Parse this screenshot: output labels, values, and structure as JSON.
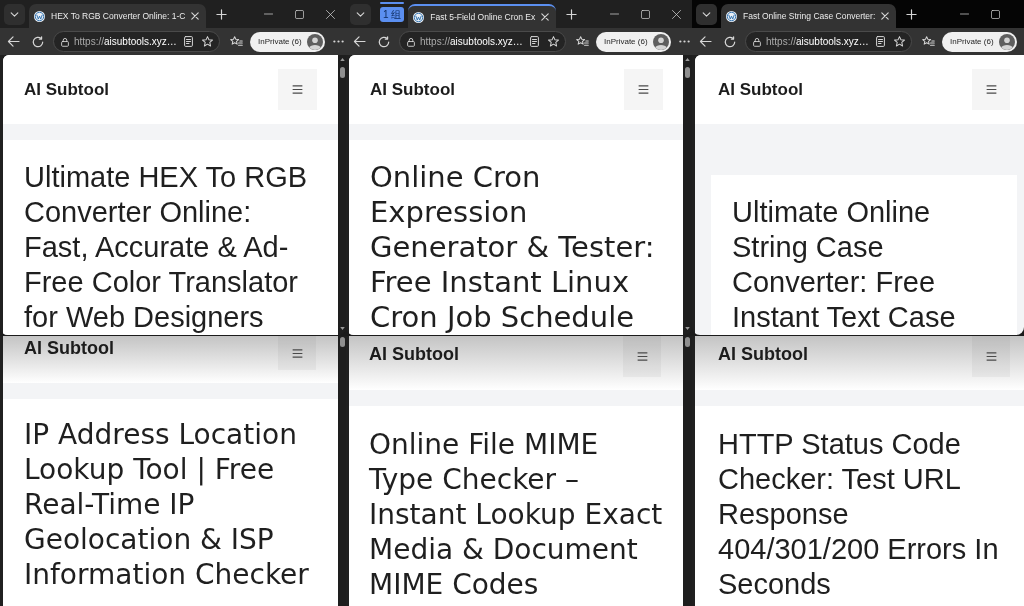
{
  "windows": [
    {
      "kind": "browser",
      "focused": false,
      "tabs": [
        {
          "title": "HEX To RGB Converter Online: 1-C",
          "selected": true
        }
      ],
      "toolbar": [
        {
          "kind": "back"
        },
        {
          "kind": "refresh"
        },
        {
          "kind": "address",
          "scheme": "https://",
          "host": "aisubtools.xyz…"
        },
        {
          "kind": "favorites"
        },
        {
          "kind": "profile",
          "label": "InPrivate (6)"
        },
        {
          "kind": "more"
        }
      ],
      "window_buttons": [
        {
          "kind": "minimize"
        },
        {
          "kind": "maximize"
        },
        {
          "kind": "close"
        }
      ],
      "page": {
        "site_name": "AI Subtool",
        "heading": "Ultimate HEX To RGB Converter Online: Fast, Accurate & Ad-Free Color Translator for Web Designers"
      }
    },
    {
      "kind": "browser",
      "focused": false,
      "tab_group": {
        "label": "1 组"
      },
      "tabs": [
        {
          "title": "Fast 5-Field Online Cron Ex",
          "selected": true
        }
      ],
      "toolbar": [
        {
          "kind": "back"
        },
        {
          "kind": "refresh"
        },
        {
          "kind": "address",
          "scheme": "https://",
          "host": "aisubtools.xyz…"
        },
        {
          "kind": "favorites"
        },
        {
          "kind": "profile",
          "label": "InPrivate (6)"
        },
        {
          "kind": "more"
        }
      ],
      "window_buttons": [
        {
          "kind": "minimize"
        },
        {
          "kind": "maximize"
        },
        {
          "kind": "close"
        }
      ],
      "page": {
        "site_name": "AI Subtool",
        "heading": "Online Cron Expression Generator & Tester: Free Instant Linux Cron Job Schedule"
      }
    },
    {
      "kind": "browser",
      "focused": true,
      "tabs": [
        {
          "title": "Fast Online String Case Converter:",
          "selected": true
        }
      ],
      "toolbar": [
        {
          "kind": "back"
        },
        {
          "kind": "refresh"
        },
        {
          "kind": "address",
          "scheme": "https://",
          "host": "aisubtools.xyz…"
        },
        {
          "kind": "favorites"
        },
        {
          "kind": "profile",
          "label": "InPrivate (6)"
        }
      ],
      "window_buttons": [
        {
          "kind": "minimize"
        },
        {
          "kind": "maximize"
        }
      ],
      "page": {
        "site_name": "AI Subtool",
        "heading": "Ultimate Online String Case Converter: Free Instant Text Case"
      }
    },
    {
      "kind": "page",
      "page": {
        "site_name": "AI Subtool",
        "heading": "IP Address Location Lookup Tool | Free Real-Time IP Geolocation & ISP Information Checker"
      }
    },
    {
      "kind": "page",
      "page": {
        "site_name": "AI Subtool",
        "heading": "Online File MIME Type Checker – Instant Lookup Exact Media & Document MIME Codes"
      }
    },
    {
      "kind": "page",
      "page": {
        "site_name": "AI Subtool",
        "heading": "HTTP Status Code Checker: Test URL Response 404/301/200 Errors In Seconds"
      }
    }
  ]
}
